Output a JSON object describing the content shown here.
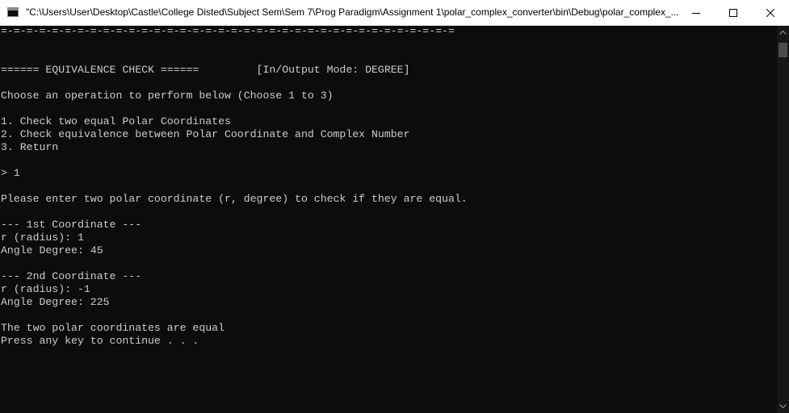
{
  "window": {
    "title": "\"C:\\Users\\User\\Desktop\\Castle\\College Disted\\Subject Sem\\Sem 7\\Prog Paradigm\\Assignment 1\\polar_complex_converter\\bin\\Debug\\polar_complex_...",
    "icon": "console-app-icon",
    "controls": {
      "minimize_icon": "minimize-icon",
      "maximize_icon": "maximize-icon",
      "close_icon": "close-icon"
    }
  },
  "console": {
    "lines": [
      "=-=-=-=-=-=-=-=-=-=-=-=-=-=-=-=-=-=-=-=-=-=-=-=-=-=-=-=-=-=-=-=-=-=-=-=",
      "",
      "",
      "====== EQUIVALENCE CHECK ======         [In/Output Mode: DEGREE]",
      "",
      "Choose an operation to perform below (Choose 1 to 3)",
      "",
      "1. Check two equal Polar Coordinates",
      "2. Check equivalence between Polar Coordinate and Complex Number",
      "3. Return",
      "",
      "> 1",
      "",
      "Please enter two polar coordinate (r, degree) to check if they are equal.",
      "",
      "--- 1st Coordinate ---",
      "r (radius): 1",
      "Angle Degree: 45",
      "",
      "--- 2nd Coordinate ---",
      "r (radius): -1",
      "Angle Degree: 225",
      "",
      "The two polar coordinates are equal",
      "Press any key to continue . . ."
    ]
  },
  "colors": {
    "console_bg": "#0c0c0c",
    "console_text": "#cccccc",
    "titlebar_bg": "#ffffff",
    "scrollbar_bg": "#171717",
    "scroll_thumb": "#4d4d4d"
  }
}
